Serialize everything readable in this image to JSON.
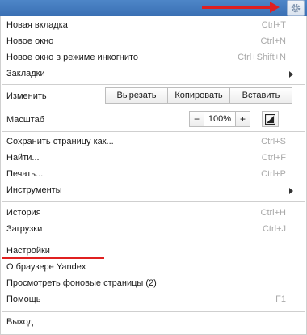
{
  "colors": {
    "accent": "#3a6fb3",
    "annotation": "#e02020",
    "shortcut": "#a8a8a8"
  },
  "icons": {
    "settings": "gear-icon",
    "fullscreen": "fullscreen-icon",
    "submenu": "chevron-right-icon"
  },
  "menu": {
    "new_tab": {
      "label": "Новая вкладка",
      "shortcut": "Ctrl+T"
    },
    "new_window": {
      "label": "Новое окно",
      "shortcut": "Ctrl+N"
    },
    "new_incognito": {
      "label": "Новое окно в режиме инкогнито",
      "shortcut": "Ctrl+Shift+N"
    },
    "bookmarks": {
      "label": "Закладки"
    },
    "edit": {
      "label": "Изменить",
      "cut": "Вырезать",
      "copy": "Копировать",
      "paste": "Вставить"
    },
    "zoom": {
      "label": "Масштаб",
      "minus": "−",
      "value": "100%",
      "plus": "+"
    },
    "save_page": {
      "label": "Сохранить страницу как...",
      "shortcut": "Ctrl+S"
    },
    "find": {
      "label": "Найти...",
      "shortcut": "Ctrl+F"
    },
    "print": {
      "label": "Печать...",
      "shortcut": "Ctrl+P"
    },
    "tools": {
      "label": "Инструменты"
    },
    "history": {
      "label": "История",
      "shortcut": "Ctrl+H"
    },
    "downloads": {
      "label": "Загрузки",
      "shortcut": "Ctrl+J"
    },
    "settings": {
      "label": "Настройки"
    },
    "about": {
      "label": "О браузере Yandex"
    },
    "background_pages": {
      "label": "Просмотреть фоновые страницы (2)"
    },
    "help": {
      "label": "Помощь",
      "shortcut": "F1"
    },
    "exit": {
      "label": "Выход"
    }
  }
}
